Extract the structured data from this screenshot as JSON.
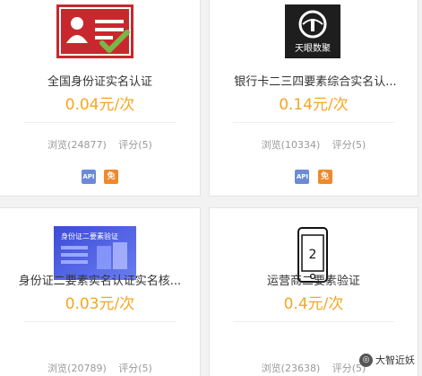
{
  "colors": {
    "price": "#f5a623",
    "api_badge": "#6b8bd6",
    "free_badge": "#f0892b",
    "id_card_red": "#c8282d",
    "check_green": "#7ab648"
  },
  "cards": [
    {
      "thumbnail_icon": "id-card-verified-icon",
      "title": "全国身份证实名认证",
      "price": "0.04元/次",
      "views": "浏览(24877)",
      "rating": "评分(5)",
      "badges": [
        "API",
        "免"
      ]
    },
    {
      "thumbnail_icon": "tianyan-logo",
      "logo_text": "天眼数聚",
      "title": "银行卡二三四要素综合实名认...",
      "price": "0.14元/次",
      "views": "浏览(10334)",
      "rating": "评分(5)",
      "badges": [
        "API",
        "免"
      ]
    },
    {
      "thumbnail_icon": "id-two-factor-banner",
      "banner_text": "身份证二要素验证",
      "title": "身份证二要素实名认证实名核...",
      "price": "0.03元/次",
      "views": "浏览(20789)",
      "rating": "评分(5)"
    },
    {
      "thumbnail_icon": "mobile-phone-icon",
      "phone_digit": "2",
      "title": "运营商二要素验证",
      "price": "0.4元/次",
      "views": "浏览(23638)",
      "rating": "评分(5)"
    }
  ],
  "watermark": {
    "text": "大智近妖"
  }
}
